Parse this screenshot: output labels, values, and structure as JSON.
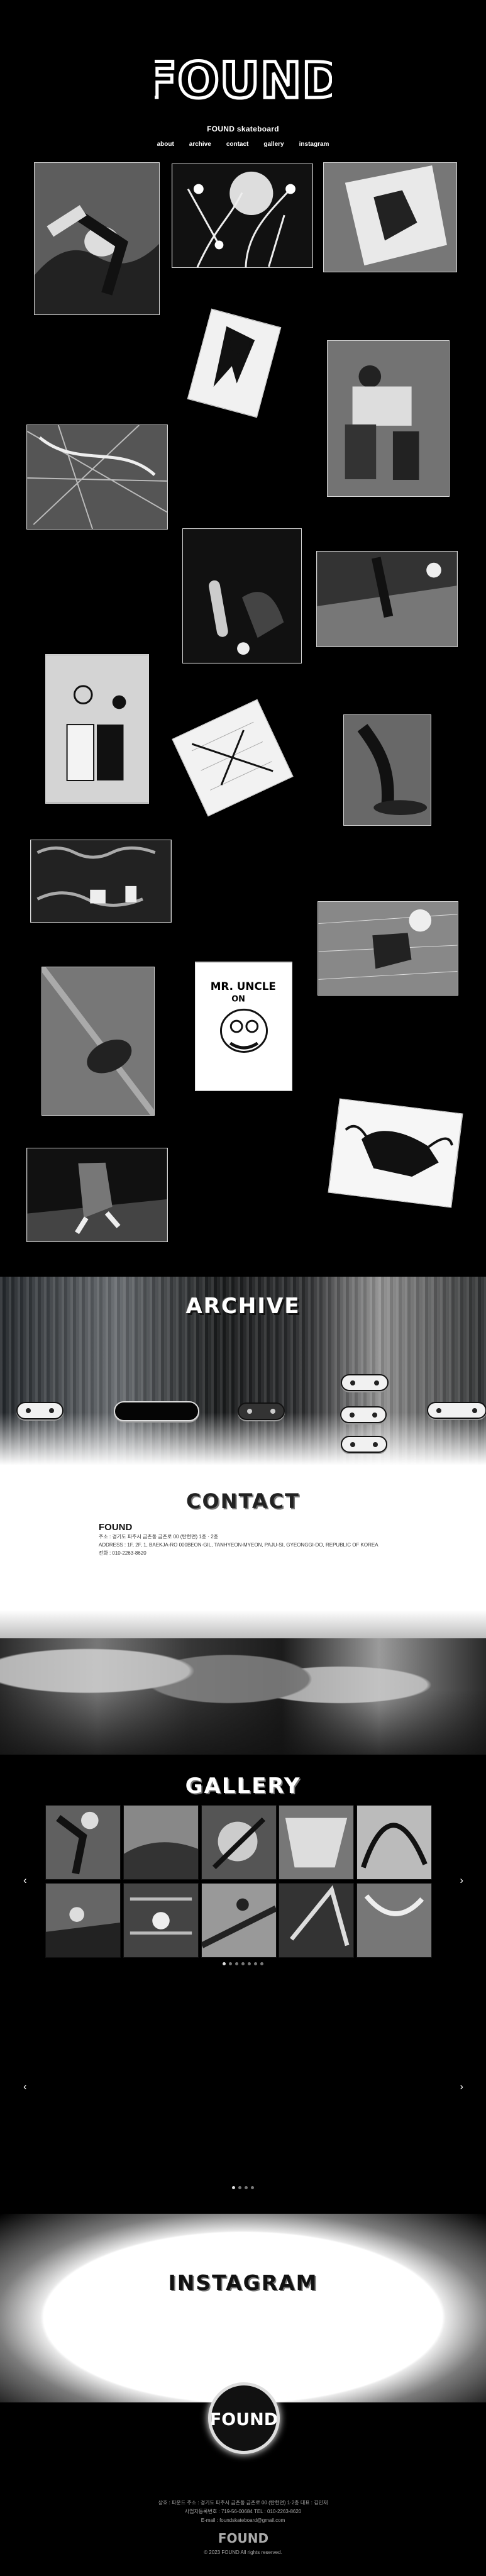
{
  "header": {
    "logo_text": "FOUND",
    "title": "FOUND skateboard",
    "nav": [
      "about",
      "archive",
      "contact",
      "gallery",
      "instagram"
    ]
  },
  "sections": {
    "archive": "ARCHIVE",
    "contact": "CONTACT",
    "gallery": "GALLERY",
    "instagram": "INSTAGRAM"
  },
  "contact": {
    "brand": "FOUND",
    "lines": [
      "주소 : 경기도 파주시 금촌동 금촌로 00 (탄현면) 1층 · 2층",
      "ADDRESS : 1F, 2F, 1, BAEKJA-RO 000BEON-GIL, TANHYEON-MYEON, PAJU-SI, GYEONGGI-DO, REPUBLIC OF KOREA",
      "전화 : 010-2263-8620"
    ]
  },
  "gallery": {
    "left_arrow": "‹",
    "right_arrow": "›"
  },
  "footer": {
    "lines": [
      "상호 : 파운드   주소 : 경기도 파주시 금촌동 금촌로 00 (탄현면) 1·2층   대표 : 김민재",
      "사업자등록번호 : 719-56-00684   TEL : 010-2263-8620",
      "E-mail : foundskateboard@gmail.com"
    ],
    "logo_text": "FOUND",
    "copyright": "© 2023 FOUND All rights reserved."
  },
  "colors": {
    "background": "#000000",
    "text": "#FFFFFF",
    "contact_background": "#FFFFFF"
  },
  "icons": {
    "logo": "found-logo",
    "left": "chevron-left-icon",
    "right": "chevron-right-icon"
  }
}
